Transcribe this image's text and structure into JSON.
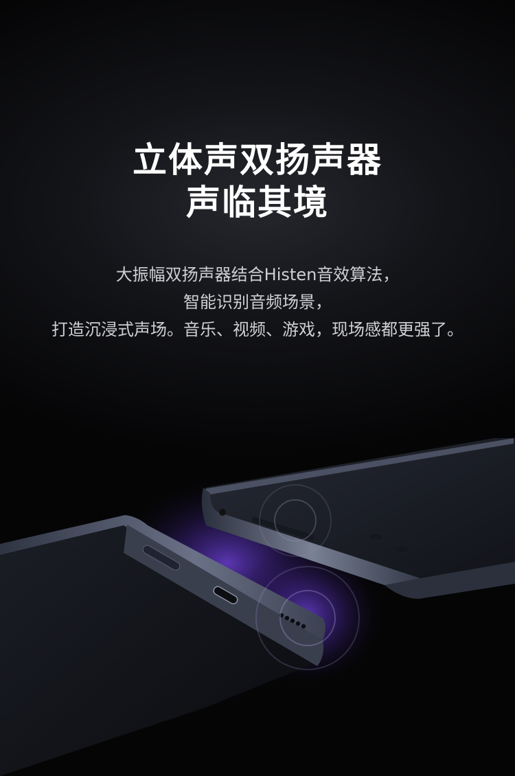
{
  "headline": {
    "line1": "立体声双扬声器",
    "line2": "声临其境"
  },
  "description": {
    "line1": "大振幅双扬声器结合Histen音效算法，",
    "line2": "智能识别音频场景，",
    "line3": "打造沉浸式声场。音乐、视频、游戏，现场感都更强了。"
  },
  "colors": {
    "background": "#050506",
    "headline": "#ffffff",
    "description": "#cfd0d4",
    "phone_frame": "#3b4151",
    "glow": "#6a3fd0"
  }
}
